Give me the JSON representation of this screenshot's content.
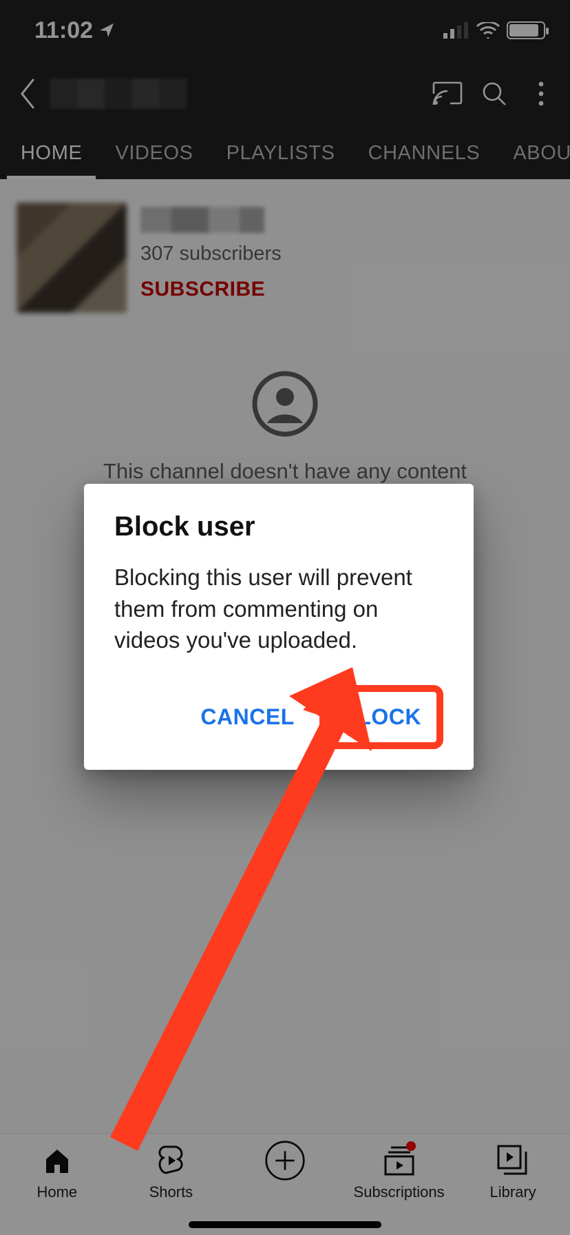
{
  "statusbar": {
    "time": "11:02"
  },
  "tabs": [
    "HOME",
    "VIDEOS",
    "PLAYLISTS",
    "CHANNELS",
    "ABOUT"
  ],
  "channel": {
    "subscriber_text": "307 subscribers",
    "subscribe_label": "SUBSCRIBE"
  },
  "empty_state_text": "This channel doesn't have any content",
  "dialog": {
    "title": "Block user",
    "body": "Blocking this user will prevent them from commenting on videos you've uploaded.",
    "cancel_label": "CANCEL",
    "block_label": "BLOCK"
  },
  "bottomnav": {
    "home": "Home",
    "shorts": "Shorts",
    "subscriptions": "Subscriptions",
    "library": "Library"
  }
}
